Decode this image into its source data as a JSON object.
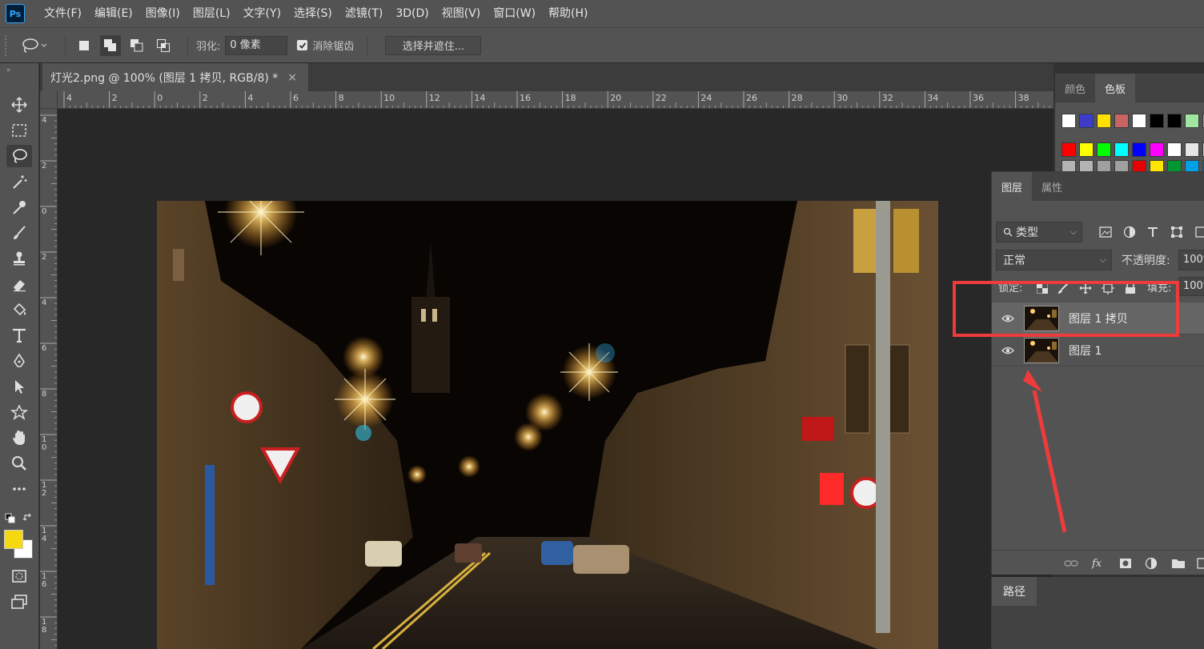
{
  "app": {
    "logo_text": "Ps"
  },
  "menu": [
    "文件(F)",
    "编辑(E)",
    "图像(I)",
    "图层(L)",
    "文字(Y)",
    "选择(S)",
    "滤镜(T)",
    "3D(D)",
    "视图(V)",
    "窗口(W)",
    "帮助(H)"
  ],
  "options": {
    "feather_label": "羽化:",
    "feather_value": "0 像素",
    "antialias_label": "消除锯齿",
    "antialias_checked": true,
    "select_mask_label": "选择并遮住..."
  },
  "document": {
    "tab_title": "灯光2.png @ 100% (图层 1 拷贝, RGB/8) *",
    "close_glyph": "×"
  },
  "ruler": {
    "horizontal": [
      "4",
      "2",
      "0",
      "2",
      "4",
      "6",
      "8",
      "10",
      "12",
      "14",
      "16",
      "18",
      "20",
      "22",
      "24",
      "26",
      "28",
      "30",
      "32",
      "34",
      "36",
      "38"
    ],
    "vertical": [
      "4",
      "2",
      "0",
      "2",
      "4",
      "6",
      "8",
      "1 0",
      "1 2",
      "1 4",
      "1 6",
      "1 8"
    ]
  },
  "swatches": {
    "tabs": [
      "颜色",
      "色板"
    ],
    "active_tab": "色板",
    "row1": [
      "#ffffff",
      "#3c3cc8",
      "#ffe000",
      "#c86464",
      "#ffffff",
      "#000000",
      "#000000",
      "#a0e6a0",
      "#a0a0a0"
    ],
    "row2": [
      "#ff0000",
      "#ffff00",
      "#00ff00",
      "#00ffff",
      "#0000ff",
      "#ff00ff",
      "#ffffff",
      "#e6e6e6",
      "#cccccc"
    ],
    "row3": [
      "#b4b4b4",
      "#b4b4b4",
      "#a0a0a0",
      "#a0a0a0",
      "#e60000",
      "#ffe600",
      "#009632",
      "#00a0e6",
      "#0064c8"
    ]
  },
  "layers": {
    "tabs": [
      "图层",
      "属性"
    ],
    "active_tab": "图层",
    "filter_kind": "类型",
    "blend_mode": "正常",
    "opacity_label": "不透明度:",
    "opacity_value": "100%",
    "lock_label": "锁定:",
    "fill_label": "填充:",
    "fill_value": "100%",
    "items": [
      {
        "name": "图层 1 拷贝",
        "selected": true,
        "visible": true
      },
      {
        "name": "图层 1",
        "selected": false,
        "visible": true
      }
    ]
  },
  "paths": {
    "tab": "路径"
  },
  "colors": {
    "foreground": "#f5d80f",
    "background": "#ffffff",
    "annotation": "#ee3b3b"
  }
}
